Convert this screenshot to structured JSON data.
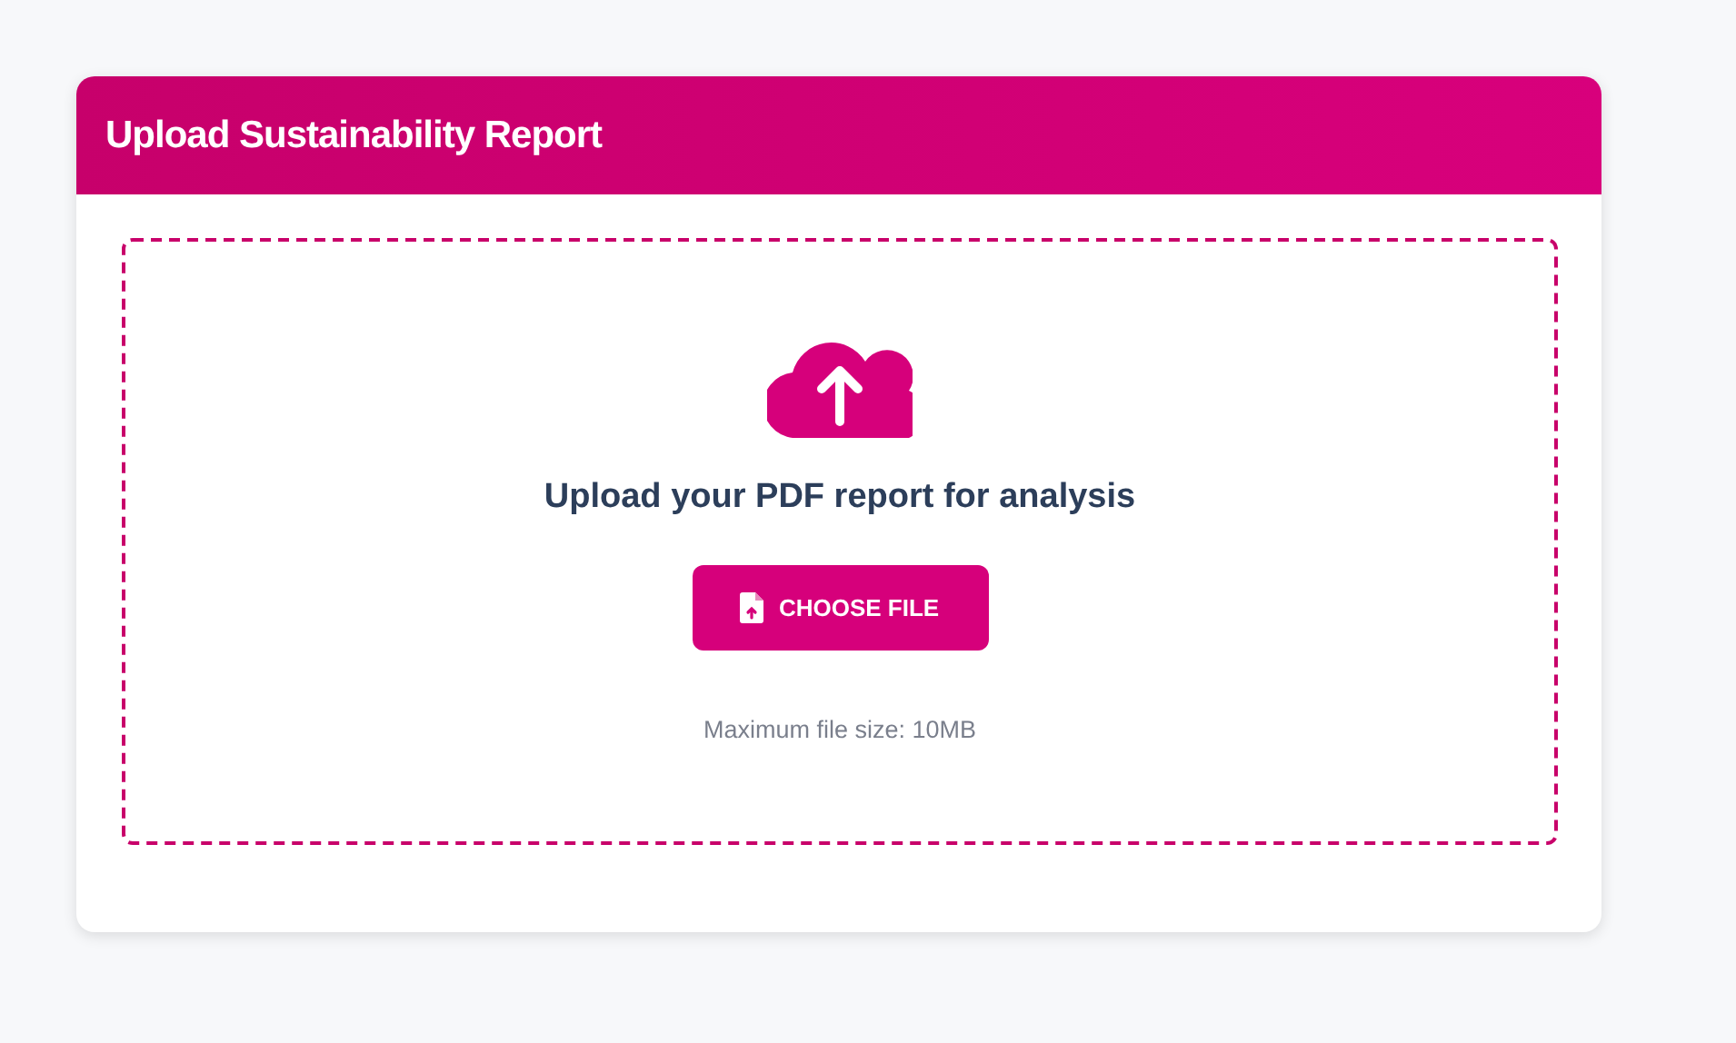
{
  "card": {
    "title": "Upload Sustainability Report"
  },
  "dropzone": {
    "heading": "Upload your PDF report for analysis",
    "button": "CHOOSE FILE",
    "hint": "Maximum file size: 10MB"
  }
}
